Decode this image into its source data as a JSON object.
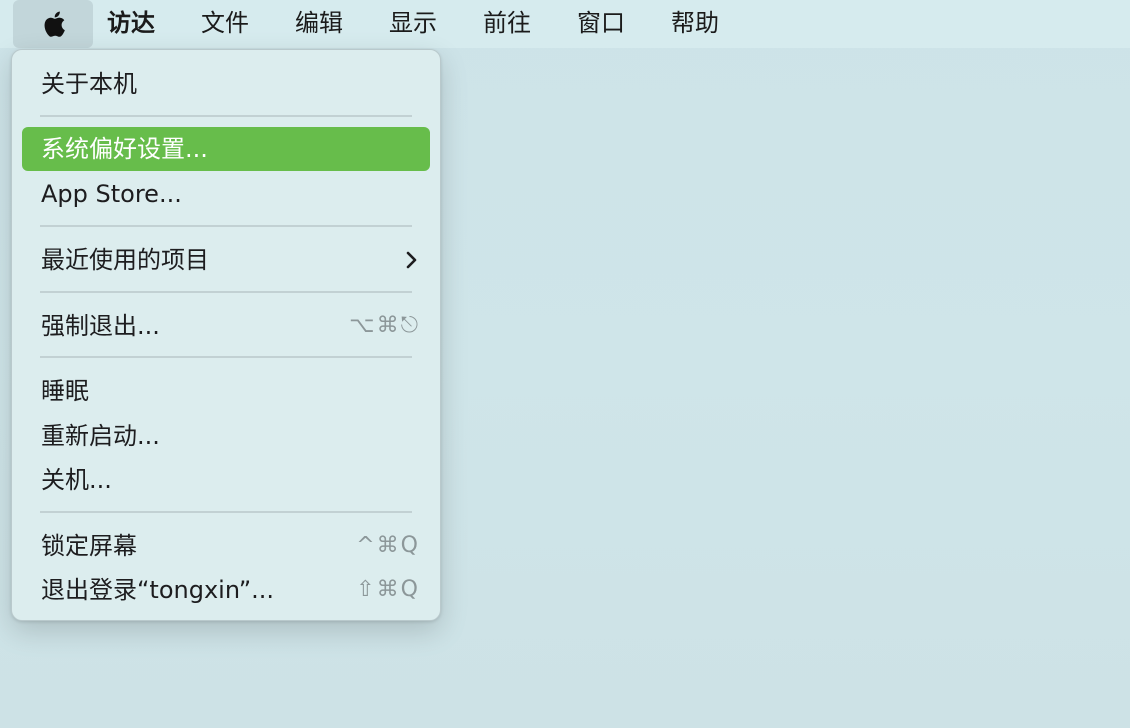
{
  "menubar": {
    "apple_icon": "apple-logo-icon",
    "app_name": "访达",
    "menus": [
      "文件",
      "编辑",
      "显示",
      "前往",
      "窗口",
      "帮助"
    ]
  },
  "apple_menu": {
    "about": "关于本机",
    "system_preferences": "系统偏好设置...",
    "app_store": "App Store...",
    "recent_items": "最近使用的项目",
    "recent_items_icon": "chevron-right-icon",
    "force_quit": "强制退出...",
    "force_quit_shortcut": "⌥⌘⎋",
    "sleep": "睡眠",
    "restart": "重新启动...",
    "shutdown": "关机...",
    "lock_screen": "锁定屏幕",
    "lock_screen_shortcut": "^⌘Q",
    "log_out": "退出登录“tongxin”...",
    "log_out_shortcut": "⇧⌘Q"
  },
  "colors": {
    "highlight": "#67bd4b",
    "menubar": "#d6ebee",
    "desktop": "#cfe4e8",
    "menu_bg": "#dcedee"
  }
}
